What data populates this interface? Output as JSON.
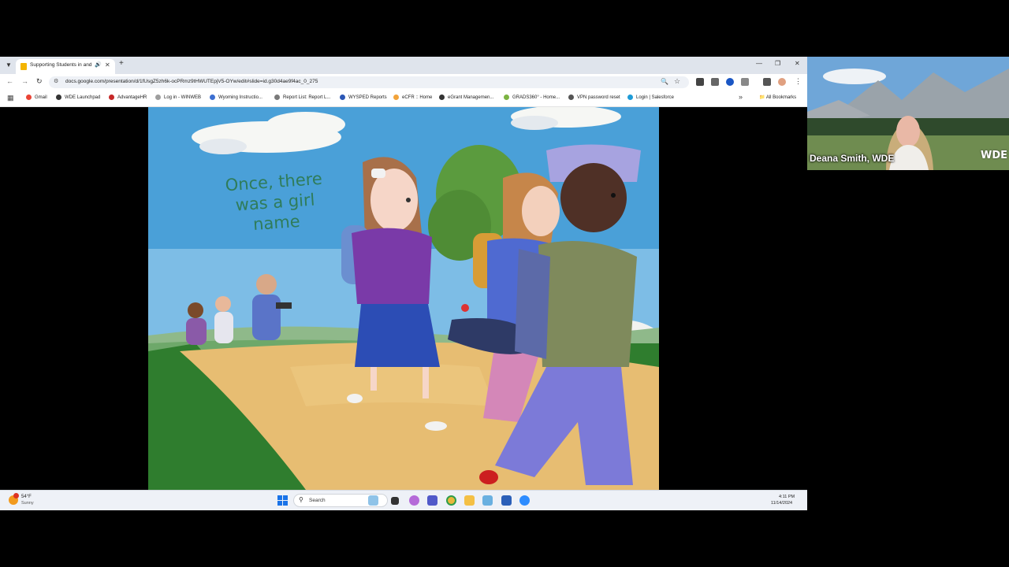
{
  "browser": {
    "tab": {
      "title": "Supporting Students in and",
      "audio_icon": "speaker-icon"
    },
    "new_tab_label": "+",
    "url": "docs.google.com/presentation/d/1fUsgZ5zh6k-ocPRmz9tHWUTEpjV5-OYw/edit#slide=id.g30d4ae9f4ac_0_275",
    "bookmarks": [
      {
        "label": "Gmail",
        "color": "#ea4335"
      },
      {
        "label": "WDE Launchpad",
        "color": "#333333"
      },
      {
        "label": "AdvantageHR",
        "color": "#c62828"
      },
      {
        "label": "Log in - WINWEB",
        "color": "#9e9e9e"
      },
      {
        "label": "Wyoming Instructio...",
        "color": "#3c6fd1"
      },
      {
        "label": "Report List: Report L...",
        "color": "#7a7a7a"
      },
      {
        "label": "WYSPED Reports",
        "color": "#2b57b5"
      },
      {
        "label": "eCFR :: Home",
        "color": "#f2a33a"
      },
      {
        "label": "eGrant Managemen...",
        "color": "#333333"
      },
      {
        "label": "GRADS360° - Home...",
        "color": "#7cb342"
      },
      {
        "label": "VPN password reset",
        "color": "#555555"
      },
      {
        "label": "Login | Salesforce",
        "color": "#1e9bd7"
      }
    ],
    "more_bookmarks": "»",
    "all_bookmarks": "All Bookmarks"
  },
  "slide": {
    "text_lines": [
      "Once, there",
      "was a girl",
      "name"
    ]
  },
  "taskbar": {
    "weather_temp": "54°F",
    "weather_cond": "Sunny",
    "search_label": "Search",
    "time": "4:11 PM",
    "date": "11/14/2024"
  },
  "video": {
    "participant_name": "Deana Smith, WDE",
    "logo_text": "WDE"
  }
}
